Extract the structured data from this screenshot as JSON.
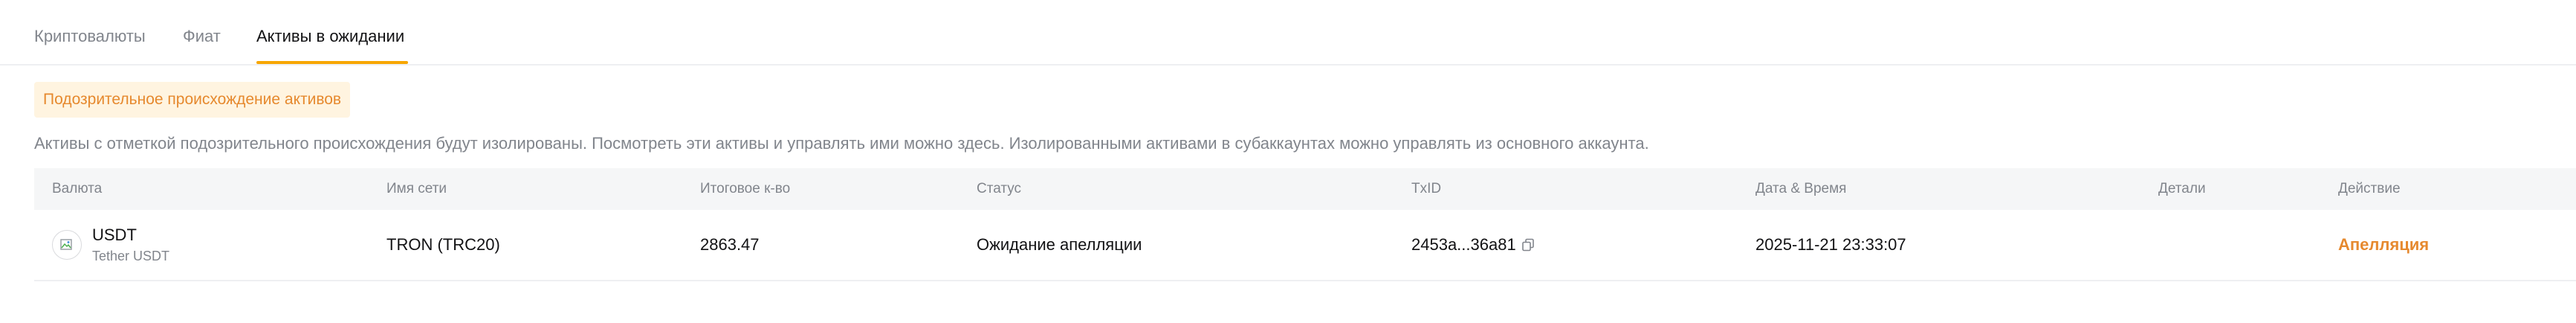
{
  "tabs": [
    {
      "label": "Криптовалюты",
      "active": false
    },
    {
      "label": "Фиат",
      "active": false
    },
    {
      "label": "Активы в ожидании",
      "active": true
    }
  ],
  "accent_color": "#f7a600",
  "warning_color": "#e6892e",
  "warning_badge": "Подозрительное происхождение активов",
  "description": "Активы с отметкой подозрительного происхождения будут изолированы. Посмотреть эти активы и управлять ими можно здесь. Изолированными активами в субаккаунтах можно управлять из основного аккаунта.",
  "table": {
    "columns": [
      "Валюта",
      "Имя сети",
      "Итоговое к-во",
      "Статус",
      "TxID",
      "Дата & Время",
      "Детали",
      "Действие"
    ],
    "rows": [
      {
        "coin": "USDT",
        "coin_full": "Tether USDT",
        "coin_icon": "broken-image-icon",
        "network": "TRON (TRC20)",
        "amount": "2863.47",
        "status": "Ожидание апелляции",
        "txid": "2453a...36a81",
        "datetime": "2025-11-21 23:33:07",
        "details": "",
        "action": "Апелляция"
      }
    ]
  }
}
